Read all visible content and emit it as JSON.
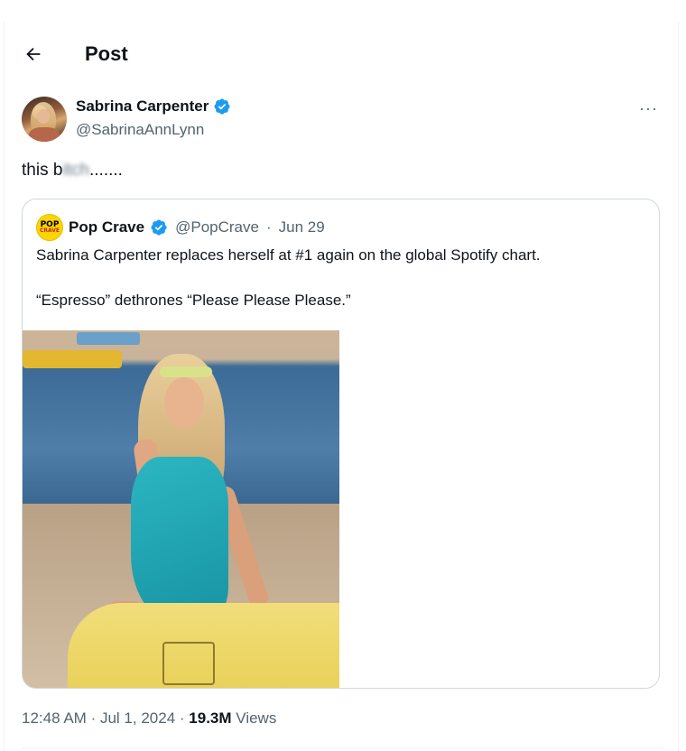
{
  "header": {
    "title": "Post"
  },
  "post": {
    "author_name": "Sabrina Carpenter",
    "author_handle": "@SabrinaAnnLynn",
    "text_prefix": "this b",
    "text_blurred": "itch",
    "text_suffix": ".......",
    "more_label": "···"
  },
  "quote": {
    "logo_line1": "POP",
    "logo_line2": "CRAVE",
    "name": "Pop Crave",
    "handle": "@PopCrave",
    "separator": "·",
    "date": "Jun 29",
    "line1": "Sabrina Carpenter replaces herself at #1 again on the global Spotify chart.",
    "line2": "“Espresso” dethrones “Please Please Please.”"
  },
  "meta": {
    "time": "12:48 AM",
    "sep1": "·",
    "date": "Jul 1, 2024",
    "sep2": "·",
    "views_count": "19.3M",
    "views_label": "Views"
  },
  "colors": {
    "verified_blue": "#1d9bf0",
    "secondary_text": "#536471",
    "border": "#cfd9de"
  }
}
